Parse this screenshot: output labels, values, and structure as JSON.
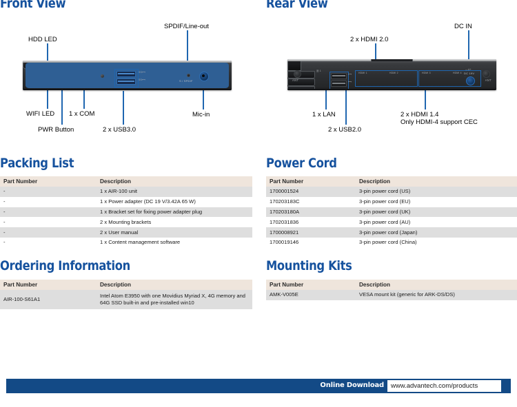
{
  "sections": {
    "front_view": "Front View",
    "rear_view": "Rear View",
    "packing_list": "Packing List",
    "power_cord": "Power Cord",
    "ordering_information": "Ordering Information",
    "mounting_kits": "Mounting Kits"
  },
  "front_callouts": {
    "hdd_led": "HDD LED",
    "spdif_lineout": "SPDIF/Line-out",
    "wifi_led": "WIFI LED",
    "com": "1 x COM",
    "mic_in": "Mic-in",
    "pwr_button": "PWR Button",
    "usb30": "2 x USB3.0"
  },
  "front_silkscreen": {
    "spdif": "S / SPDIF",
    "usb_ss1": "SS⟷",
    "usb_ss2": "SS⟷"
  },
  "rear_callouts": {
    "hdmi20": "2 x HDMI 2.0",
    "dc_in": "DC IN",
    "lan": "1 x LAN",
    "usb20": "2 x USB2.0",
    "hdmi14_line1": "2 x HDMI 1.4",
    "hdmi14_line2": "Only HDMI-4 support CEC"
  },
  "rear_silkscreen": {
    "ant_left": "ANT",
    "ant_right": "ANT",
    "lan": "品 1",
    "hdmi1": "HDMI 1",
    "hdmi2": "HDMI 2",
    "hdmi3": "HDMI 3",
    "hdmi4": "HDMI 4",
    "dc_polarity": "—⊙+",
    "dc_voltage": "DC 19V"
  },
  "tables": {
    "packing_list": {
      "headers": [
        "Part Number",
        "Description"
      ],
      "rows": [
        [
          "-",
          "1 x AIR-100 unit"
        ],
        [
          "-",
          "1 x Power adapter (DC 19 V/3.42A 65 W)"
        ],
        [
          "-",
          "1 x Bracket set for fixing power adapter plug"
        ],
        [
          "-",
          "2 x Mounting brackets"
        ],
        [
          "-",
          "2 x User manual"
        ],
        [
          "-",
          "1 x Content management software"
        ]
      ]
    },
    "power_cord": {
      "headers": [
        "Part Number",
        "Description"
      ],
      "rows": [
        [
          "1700001524",
          "3-pin power cord (US)"
        ],
        [
          "170203183C",
          "3-pin power cord (EU)"
        ],
        [
          "170203180A",
          "3-pin power cord (UK)"
        ],
        [
          "1702031836",
          "3-pin power cord (AU)"
        ],
        [
          "1700008921",
          "3-pin power cord (Japan)"
        ],
        [
          "1700019146",
          "3-pin power cord (China)"
        ]
      ]
    },
    "ordering_information": {
      "headers": [
        "Part Number",
        "Description"
      ],
      "rows": [
        [
          "AIR-100-S61A1",
          "Intel Atom E3950 with one Movidius Myriad X, 4G memory and 64G SSD built-in and pre-installed win10"
        ]
      ]
    },
    "mounting_kits": {
      "headers": [
        "Part Number",
        "Description"
      ],
      "rows": [
        [
          "AMK-V005E",
          "VESA mount kit (generic for ARK-DS/DS)"
        ]
      ]
    }
  },
  "footer": {
    "label": "Online Download",
    "url": "www.advantech.com/products"
  },
  "colors": {
    "heading_blue": "#16529e",
    "leader_blue": "#1f66b0",
    "footer_blue": "#134a86",
    "table_header": "#efe5dc",
    "row_alt": "#dedede"
  }
}
